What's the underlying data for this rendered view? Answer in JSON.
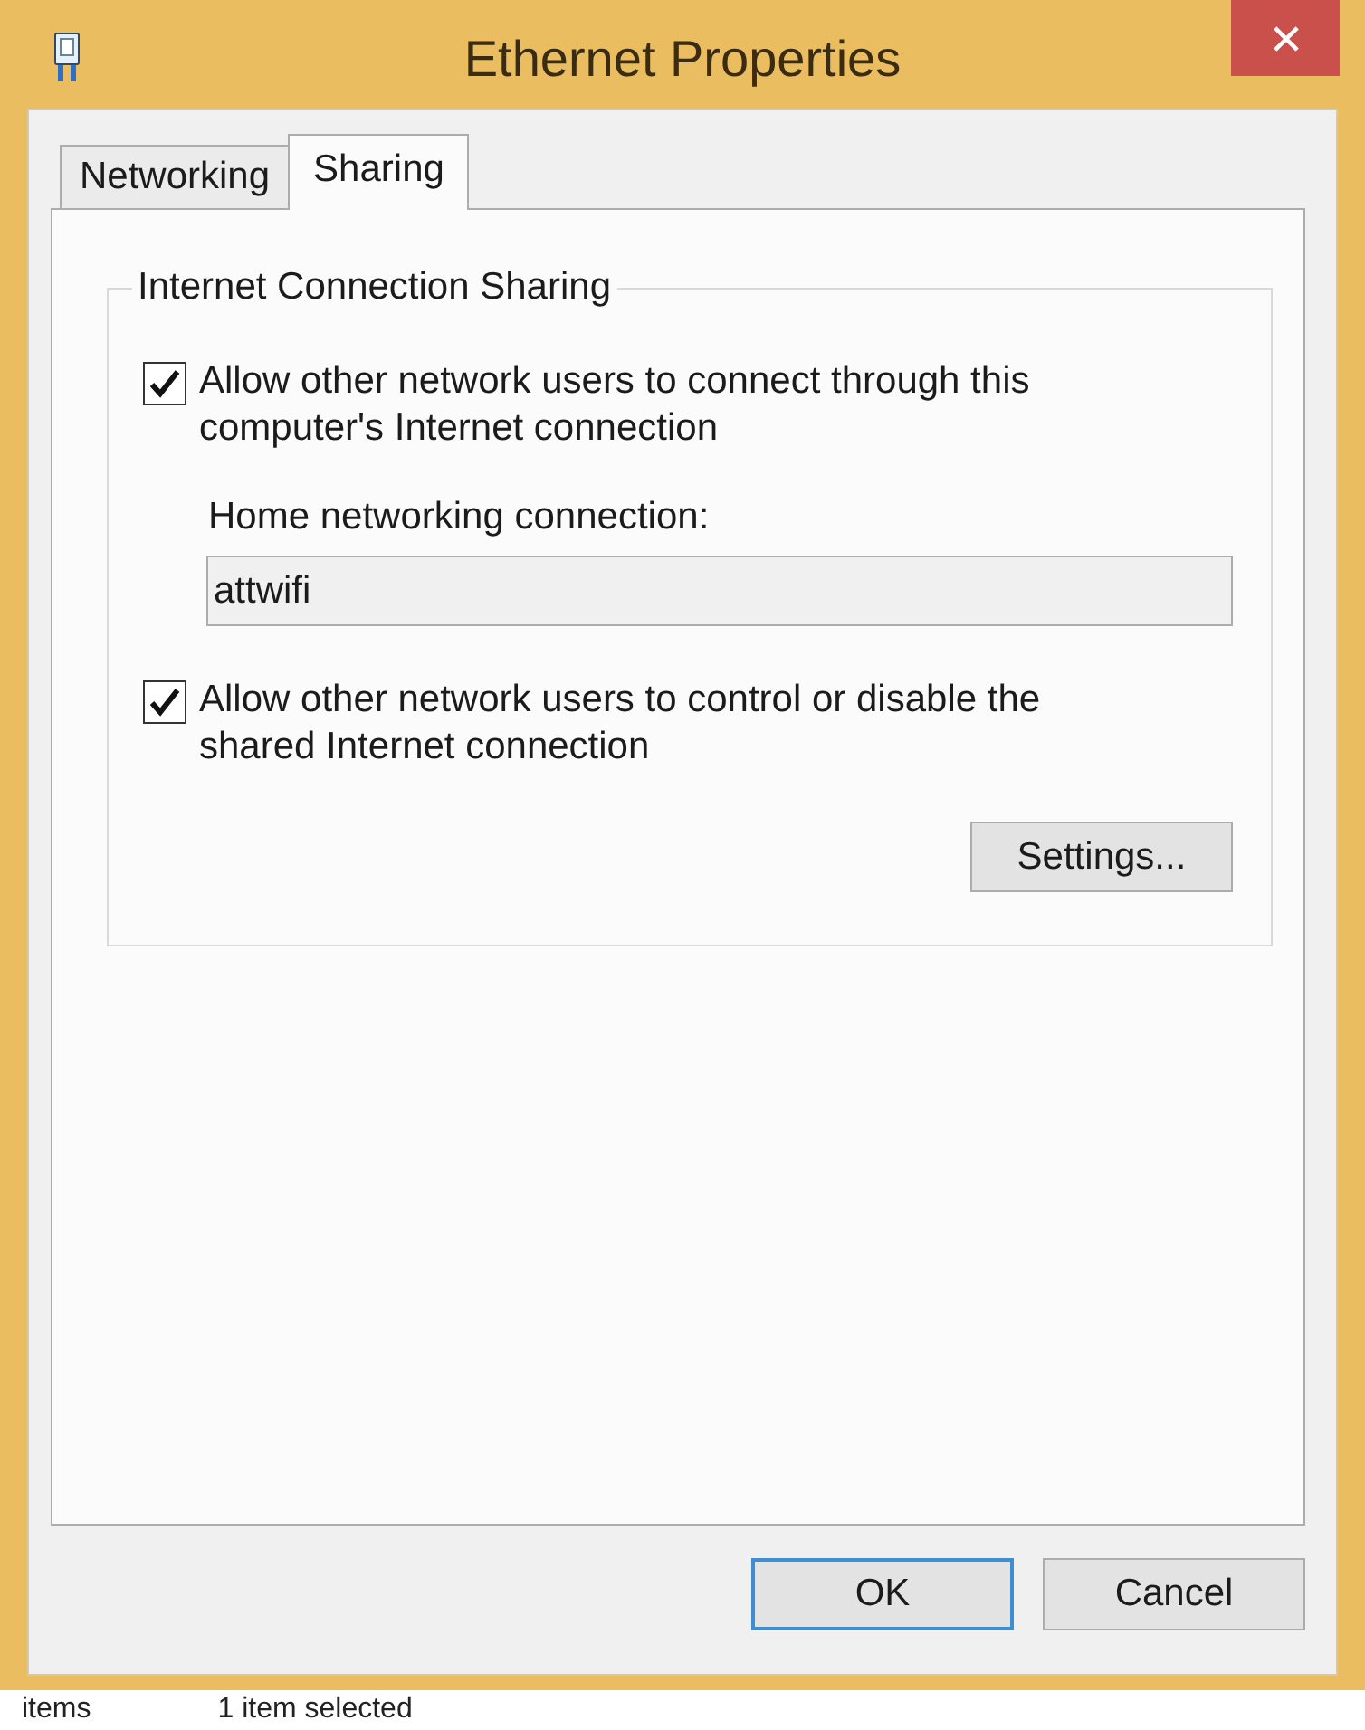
{
  "window": {
    "title": "Ethernet Properties"
  },
  "tabs": [
    {
      "label": "Networking",
      "selected": false
    },
    {
      "label": "Sharing",
      "selected": true
    }
  ],
  "group": {
    "title": "Internet Connection Sharing",
    "items": [
      {
        "kind": "checkbox",
        "label": "Allow other network users to connect through this computer's Internet connection",
        "checked": true
      },
      {
        "kind": "field",
        "label": "Home networking connection:",
        "value": "attwifi"
      },
      {
        "kind": "checkbox",
        "label": "Allow other network users to control or disable the shared Internet connection",
        "checked": true
      }
    ],
    "button": "Settings..."
  },
  "buttons": [
    {
      "label": "OK",
      "default": true
    },
    {
      "label": "Cancel",
      "default": false
    }
  ],
  "status_bar": {
    "items": [
      "items",
      "1 item selected"
    ]
  }
}
